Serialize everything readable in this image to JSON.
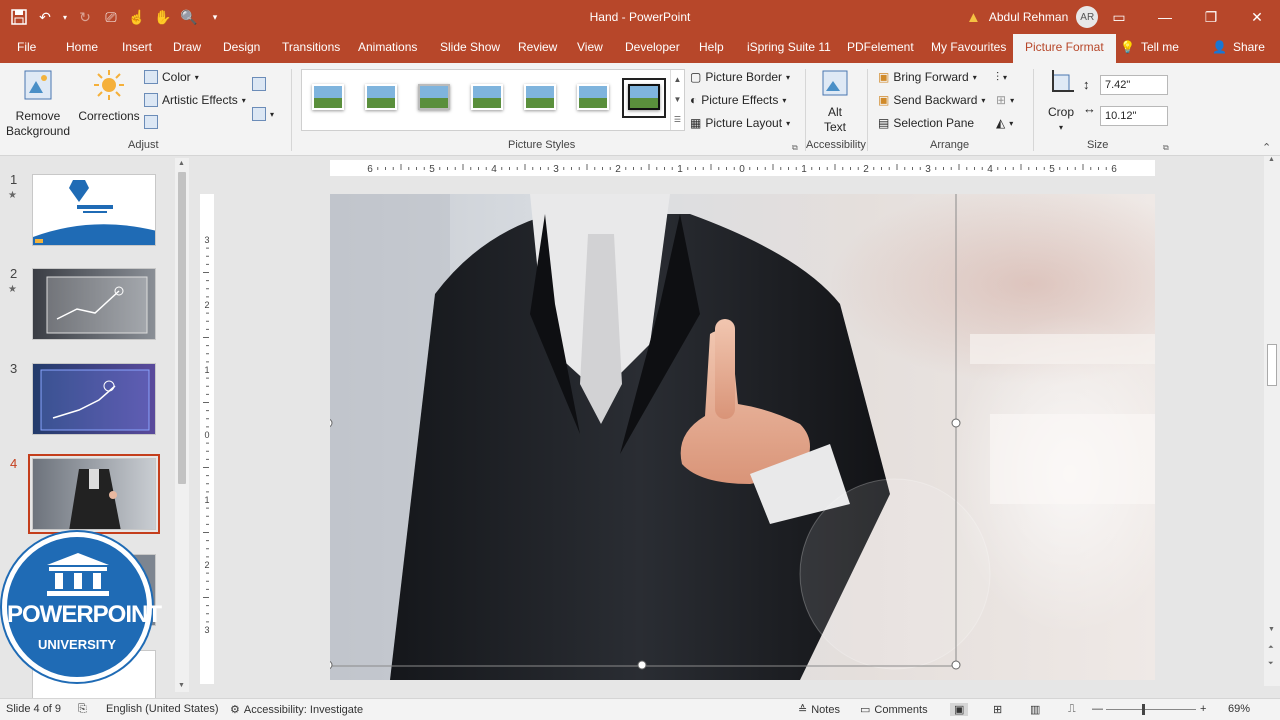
{
  "window": {
    "title": "Hand  -  PowerPoint",
    "user_name": "Abdul Rehman",
    "user_initials": "AR"
  },
  "tabs": [
    {
      "label": "File"
    },
    {
      "label": "Home"
    },
    {
      "label": "Insert"
    },
    {
      "label": "Draw"
    },
    {
      "label": "Design"
    },
    {
      "label": "Transitions"
    },
    {
      "label": "Animations"
    },
    {
      "label": "Slide Show"
    },
    {
      "label": "Review"
    },
    {
      "label": "View"
    },
    {
      "label": "Developer"
    },
    {
      "label": "Help"
    },
    {
      "label": "iSpring Suite 11"
    },
    {
      "label": "PDFelement"
    },
    {
      "label": "My Favourites"
    },
    {
      "label": "Picture Format",
      "active": true
    }
  ],
  "tell_me": "Tell me",
  "share": "Share",
  "ribbon": {
    "adjust": {
      "remove_bg": [
        "Remove",
        "Background"
      ],
      "corrections": "Corrections",
      "color": "Color",
      "artistic": "Artistic Effects",
      "label": "Adjust"
    },
    "styles": {
      "label": "Picture Styles",
      "border": "Picture Border",
      "effects": "Picture Effects",
      "layout": "Picture Layout"
    },
    "accessibility": {
      "alt_text": [
        "Alt",
        "Text"
      ],
      "label": "Accessibility"
    },
    "arrange": {
      "bring_forward": "Bring Forward",
      "send_backward": "Send Backward",
      "selection_pane": "Selection Pane",
      "label": "Arrange"
    },
    "size": {
      "crop": "Crop",
      "height": "7.42\"",
      "width": "10.12\"",
      "label": "Size"
    }
  },
  "slides": [
    {
      "num": "1",
      "star": "★"
    },
    {
      "num": "2",
      "star": "★"
    },
    {
      "num": "3",
      "star": ""
    },
    {
      "num": "4",
      "star": "",
      "active": true
    }
  ],
  "badge": {
    "title": "POWERPOINT",
    "sub": "UNIVERSITY"
  },
  "hruler_labels": [
    "6",
    "5",
    "4",
    "3",
    "2",
    "1",
    "0",
    "1",
    "2",
    "3",
    "4",
    "5",
    "6"
  ],
  "vruler_labels": [
    "3",
    "2",
    "1",
    "0",
    "1",
    "2",
    "3"
  ],
  "status": {
    "slide": "Slide 4 of 9",
    "language": "English (United States)",
    "accessibility": "Accessibility: Investigate",
    "notes": "Notes",
    "comments": "Comments",
    "zoom": "69%"
  },
  "colors": {
    "accent": "#b7472a",
    "active_slide": "#c43e1c"
  }
}
